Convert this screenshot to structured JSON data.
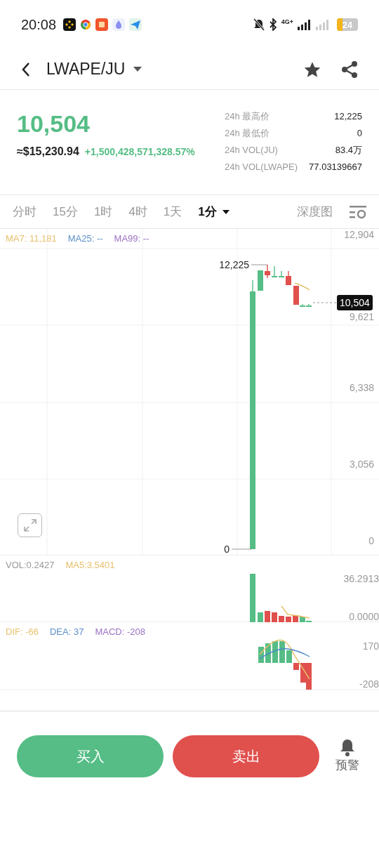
{
  "status_bar": {
    "time": "20:08",
    "network": "4G+",
    "battery": "24"
  },
  "header": {
    "pair": "LWAPE/JU"
  },
  "ticker": {
    "price": "10,504",
    "fiat": "≈$15,230.94",
    "change": "+1,500,428,571,328.57%",
    "stats": [
      {
        "label": "24h 最高价",
        "value": "12,225"
      },
      {
        "label": "24h 最低价",
        "value": "0"
      },
      {
        "label": "24h VOL(JU)",
        "value": "83.4万"
      },
      {
        "label": "24h VOL(LWAPE)",
        "value": "77.03139667"
      }
    ]
  },
  "intervals": [
    {
      "label": "分时",
      "selected": false
    },
    {
      "label": "15分",
      "selected": false
    },
    {
      "label": "1时",
      "selected": false
    },
    {
      "label": "4时",
      "selected": false
    },
    {
      "label": "1天",
      "selected": false
    },
    {
      "label": "1分",
      "selected": true
    }
  ],
  "depth_tab": "深度图",
  "main_chart": {
    "indicators": [
      {
        "label": "MA7: 11,181",
        "color": "#e8c06c"
      },
      {
        "label": "MA25: --",
        "color": "#5b8fc9"
      },
      {
        "label": "MA99: --",
        "color": "#9b72c2"
      }
    ],
    "axis_labels": [
      "12,904",
      "9,621",
      "6,338",
      "3,056",
      "0"
    ],
    "high_label": "12,225",
    "low_label": "0",
    "last_price": "10,504"
  },
  "volume_chart": {
    "indicators": [
      {
        "label": "VOL:0.2427",
        "color": "#999999"
      },
      {
        "label": "MA5:3.5401",
        "color": "#e8c06c"
      }
    ],
    "axis_labels": [
      "36.2913",
      "0.0000"
    ]
  },
  "macd_chart": {
    "indicators": [
      {
        "label": "DIF: -66",
        "color": "#e8c06c"
      },
      {
        "label": "DEA: 37",
        "color": "#5b8fc9"
      },
      {
        "label": "MACD: -208",
        "color": "#9b72c2"
      }
    ],
    "axis_labels": [
      "170",
      "-208"
    ]
  },
  "actions": {
    "buy": "买入",
    "sell": "卖出",
    "alert": "预警"
  }
}
